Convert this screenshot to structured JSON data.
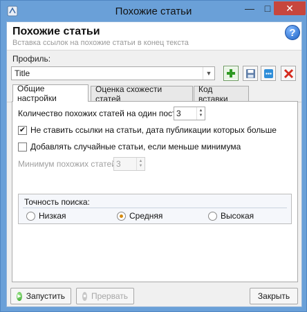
{
  "window": {
    "title": "Похожие статьи",
    "controls": {
      "minimize": "—",
      "maximize": "□",
      "close": "✕"
    }
  },
  "header": {
    "title": "Похожие статьи",
    "subtitle": "Вставка ссылок на похожие статьи в конец текста",
    "help": "?"
  },
  "profile": {
    "label": "Профиль:",
    "value": "Title",
    "toolbar": {
      "add_icon": "add-icon",
      "save_icon": "save-icon",
      "dots_icon": "more-icon",
      "delete_icon": "delete-icon"
    }
  },
  "tabs": [
    {
      "label": "Общие настройки",
      "active": true
    },
    {
      "label": "Оценка схожести статей",
      "active": false
    },
    {
      "label": "Код вставки",
      "active": false
    }
  ],
  "general": {
    "count_label": "Количество похожих статей на один пост:",
    "count_value": "3",
    "no_links_label": "Не ставить ссылки на статьи, дата публикации которых больше",
    "no_links_checked": true,
    "random_label": "Добавлять случайные статьи, если меньше минимума",
    "random_checked": false,
    "min_label": "Минимум похожих статей:",
    "min_value": "3",
    "accuracy": {
      "title": "Точность поиска:",
      "options": [
        "Низкая",
        "Средняя",
        "Высокая"
      ],
      "selected": "Средняя"
    }
  },
  "buttons": {
    "run": "Запустить",
    "stop": "Прервать",
    "close": "Закрыть"
  },
  "colors": {
    "titlebar": "#6aa0d8",
    "close_button": "#c7463d",
    "panel_bg": "#f0f0f0"
  }
}
